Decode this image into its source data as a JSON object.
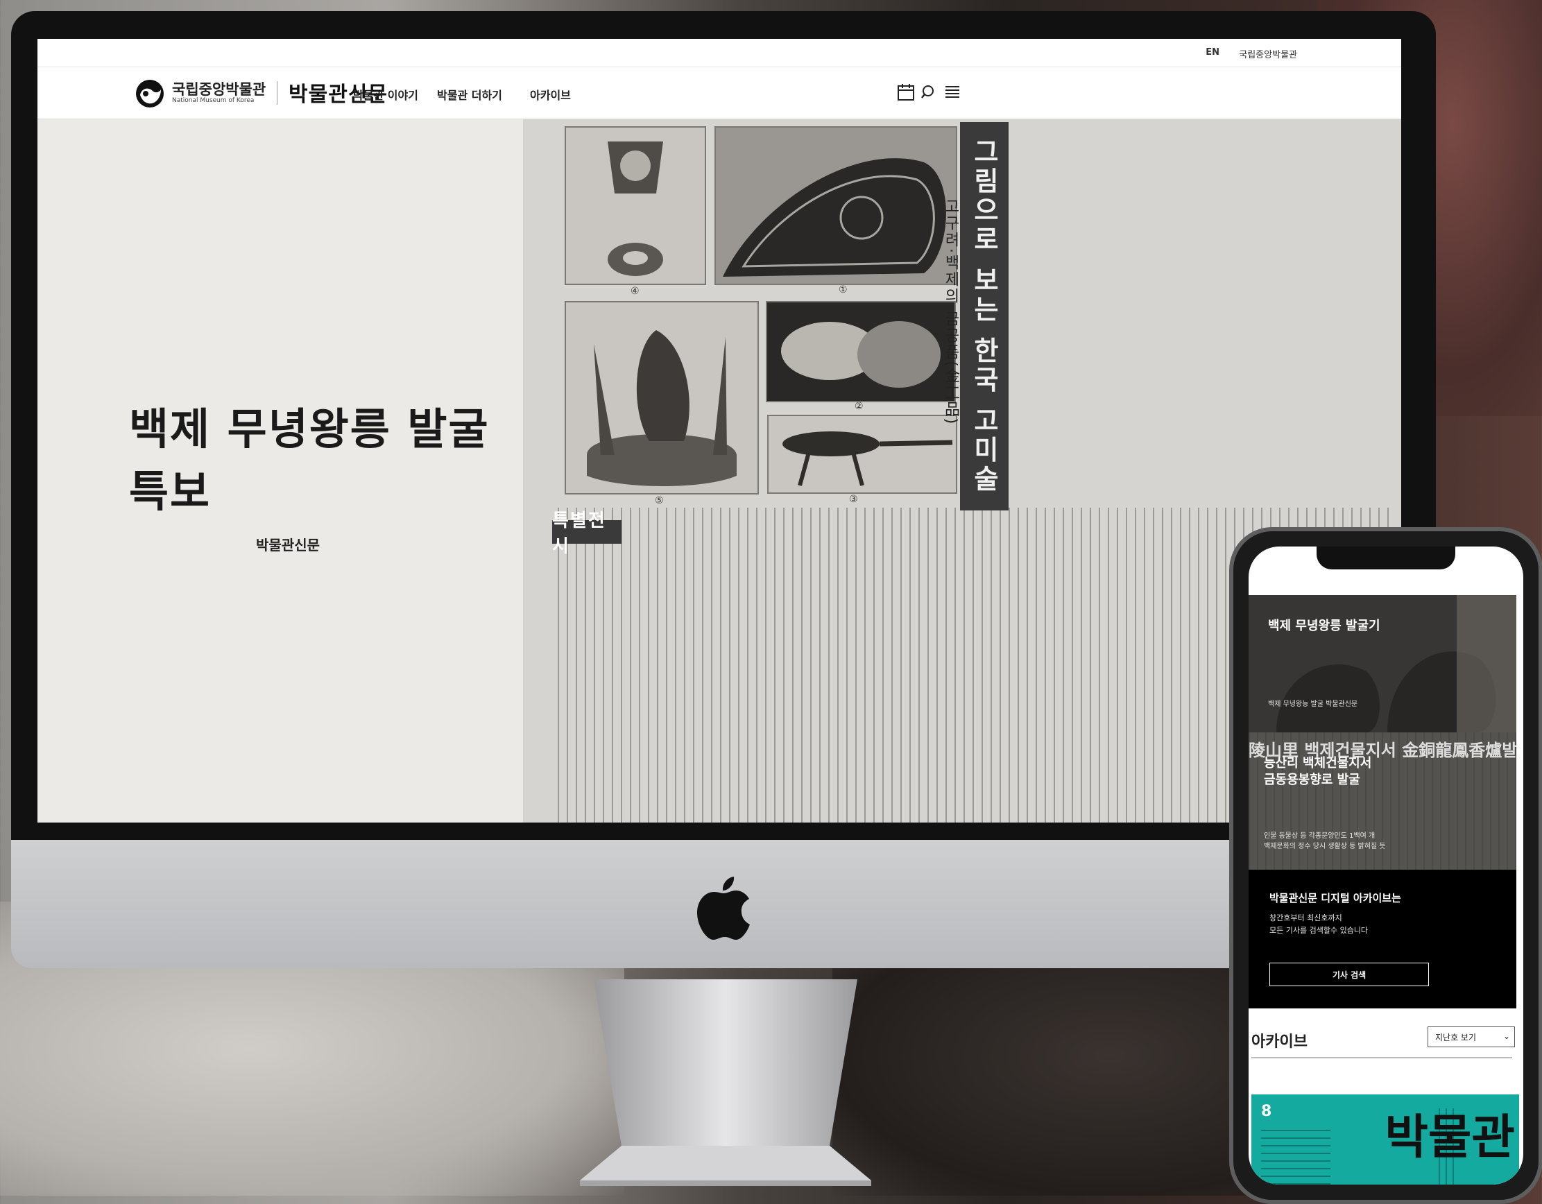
{
  "desktop": {
    "topbar": {
      "lang": "EN",
      "museum_link": "국립중앙박물관"
    },
    "logo": {
      "korean": "국립중앙박물관",
      "english": "National Museum of Korea",
      "script": "박물관신문"
    },
    "nav": [
      {
        "label": "박물관 이야기"
      },
      {
        "label": "박물관 더하기"
      },
      {
        "label": "아카이브"
      }
    ],
    "icons": [
      "calendar-icon",
      "search-icon",
      "menu-icon"
    ],
    "hero": {
      "title": "백제 무녕왕릉 발굴 특보",
      "source": "박물관신문"
    },
    "newspaper": {
      "banner": "그림으로 보는 한국 고미술",
      "subtitle": "고구려·백제의 금공품(金工品)",
      "box": "특별전시",
      "figure_numbers": [
        "④",
        "①",
        "②",
        "⑤",
        "③"
      ]
    }
  },
  "mobile": {
    "card1": {
      "title": "백제 무녕왕릉 발굴기",
      "caption": "백제 무녕왕능 발굴 박물관신문"
    },
    "card2": {
      "overlay_top": "陵山里 백제건물지서 金銅龍鳳香爐발굴",
      "title_line1": "능산리 백제건물지서",
      "title_line2": "금동용봉향로 발굴",
      "caption_line1": "인물 동물상 등 각종문양만도 1백여 개",
      "caption_line2": "백제문화의 정수 당시 생활상 등 밝혀질 듯"
    },
    "card3": {
      "title": "박물관신문 디지털 아카이브는",
      "line1": "창간호부터 최신호까지",
      "line2": "모든 기사를 검색할수 있습니다",
      "button": "기사 검색"
    },
    "archive": {
      "heading": "아카이브",
      "select": "지난호 보기"
    },
    "issue": {
      "number": "8",
      "masthead": "박물관"
    }
  },
  "colors": {
    "teal": "#14aaa0",
    "screen_bg": "#ebeae7"
  }
}
